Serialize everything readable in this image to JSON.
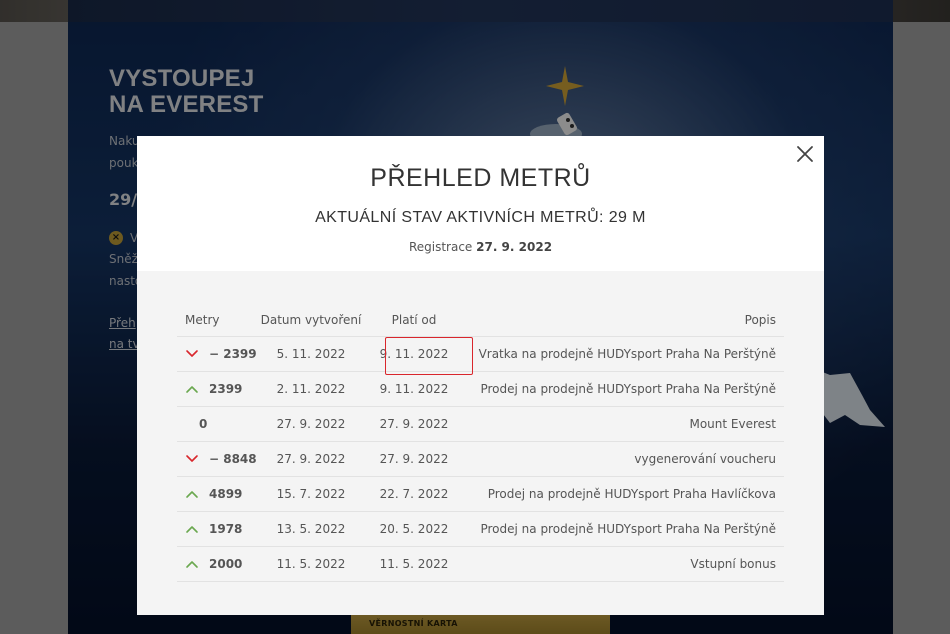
{
  "background": {
    "hero_title_line1": "VYSTOUPEJ",
    "hero_title_line2": "NA EVEREST",
    "hero_text_line1": "Naku",
    "hero_text_line2": "pouk",
    "hero_big": "29/",
    "hero_small_line1": "V",
    "hero_small_line2": "Sněž",
    "hero_small_line3": "nasto",
    "hero_link_line1": "Přeh",
    "hero_link_line2": "na tv",
    "card_label": "VĚRNOSTNÍ KARTA"
  },
  "modal": {
    "title": "PŘEHLED METRŮ",
    "subtitle": "AKTUÁLNÍ STAV AKTIVNÍCH METRŮ: 29 M",
    "registration_label": "Registrace",
    "registration_date": "27. 9. 2022",
    "colors": {
      "up": "#6aa84f",
      "down": "#d9262c",
      "highlight": "#d9262c"
    },
    "table": {
      "headers": {
        "meters": "Metry",
        "created": "Datum vytvoření",
        "valid_from": "Platí od",
        "description": "Popis"
      },
      "rows": [
        {
          "direction": "down",
          "meters": "− 2399",
          "created": "5. 11. 2022",
          "valid_from": "9. 11. 2022",
          "description": "Vratka na prodejně HUDYsport Praha Na Perštýně"
        },
        {
          "direction": "up",
          "meters": "2399",
          "created": "2. 11. 2022",
          "valid_from": "9. 11. 2022",
          "description": "Prodej na prodejně HUDYsport Praha Na Perštýně"
        },
        {
          "direction": "none",
          "meters": "0",
          "created": "27. 9. 2022",
          "valid_from": "27. 9. 2022",
          "description": "Mount Everest"
        },
        {
          "direction": "down",
          "meters": "− 8848",
          "created": "27. 9. 2022",
          "valid_from": "27. 9. 2022",
          "description": "vygenerování voucheru"
        },
        {
          "direction": "up",
          "meters": "4899",
          "created": "15. 7. 2022",
          "valid_from": "22. 7. 2022",
          "description": "Prodej na prodejně HUDYsport Praha Havlíčkova"
        },
        {
          "direction": "up",
          "meters": "1978",
          "created": "13. 5. 2022",
          "valid_from": "20. 5. 2022",
          "description": "Prodej na prodejně HUDYsport Praha Na Perštýně"
        },
        {
          "direction": "up",
          "meters": "2000",
          "created": "11. 5. 2022",
          "valid_from": "11. 5. 2022",
          "description": "Vstupní bonus"
        }
      ]
    }
  }
}
